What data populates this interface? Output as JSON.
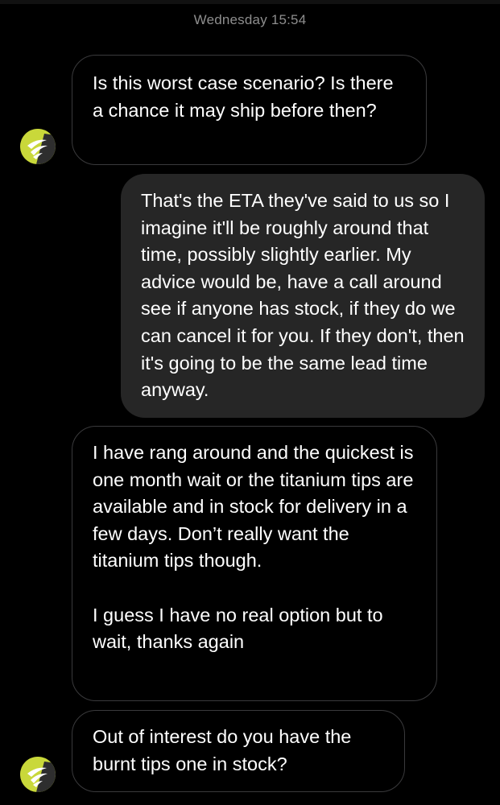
{
  "thread": {
    "timestamp": "Wednesday 15:54"
  },
  "colors": {
    "background": "#000000",
    "incoming_border": "#3a3a3c",
    "outgoing_bubble": "#262626",
    "timestamp_text": "#8e8e8e",
    "avatar_accent": "#c9d83a"
  },
  "messages": [
    {
      "direction": "incoming",
      "text": "Is this worst case scenario? Is there a chance it may ship before then?",
      "avatar_icon": "brand-logo-icon"
    },
    {
      "direction": "outgoing",
      "text": "That's the ETA they've said to us so I imagine it'll be roughly around that time, possibly slightly earlier. My advice would be, have a call around see if anyone has stock, if they do we can cancel it for you. If they don't, then it's going to be the same lead time anyway."
    },
    {
      "direction": "incoming",
      "text": "I have rang around and the quickest is one month wait or the titanium tips are available and in stock for delivery in a few days. Don’t really want the titanium tips though.\n\nI guess I have no real option but to wait, thanks again"
    },
    {
      "direction": "incoming",
      "text": "Out of interest do you have the burnt tips one in stock?",
      "avatar_icon": "brand-logo-icon"
    }
  ]
}
